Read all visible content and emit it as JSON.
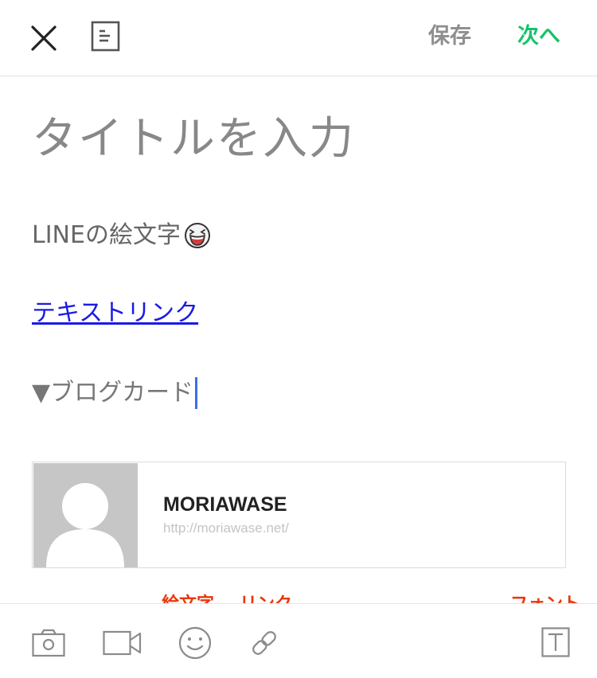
{
  "header": {
    "save_label": "保存",
    "next_label": "次へ"
  },
  "editor": {
    "title_placeholder": "タイトルを入力",
    "emoji_line_text": "LINEの絵文字",
    "link_text": "テキストリンク",
    "blogcard_label": "▼ブログカード"
  },
  "blog_card": {
    "title": "MORIAWASE",
    "url": "http://moriawase.net/"
  },
  "annotations": {
    "emoji": "絵文字",
    "link": "リンク",
    "font": "フォント"
  },
  "toolbar": {
    "icons": [
      "camera-icon",
      "video-icon",
      "smiley-icon",
      "link-icon",
      "font-icon"
    ]
  },
  "colors": {
    "accent_green": "#18c26a",
    "link_blue": "#1a1ae6",
    "annotation_red": "#e8380c",
    "caret_blue": "#3c6ee6"
  }
}
